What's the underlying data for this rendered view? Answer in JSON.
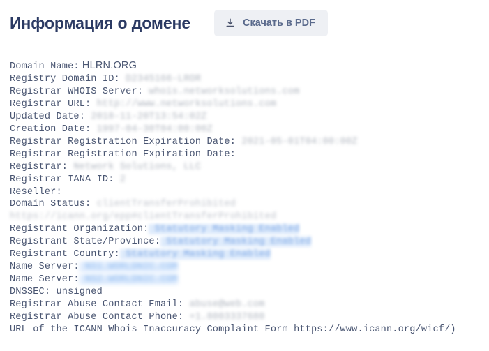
{
  "header": {
    "title": "Информация о домене",
    "download_button": {
      "label": "Скачать в PDF",
      "icon": "download-icon"
    }
  },
  "colors": {
    "title": "#2b3a63",
    "button_bg": "#eef0f4",
    "button_text": "#5a6a8c",
    "body_text": "#4a5672",
    "link_blue": "#5f93e0",
    "link_highlight": "#d9e8fb",
    "redacted_gray": "#9aa1ad",
    "page_bg": "#ffffff"
  },
  "whois": {
    "records": [
      {
        "label": "Domain Name:",
        "value": "HLRN.ORG",
        "style": "plain-sans"
      },
      {
        "label": "Registry Domain ID:",
        "value": "D2345166-LROR",
        "style": "redacted-gray"
      },
      {
        "label": "Registrar WHOIS Server:",
        "value": "whois.networksolutions.com",
        "style": "redacted-gray"
      },
      {
        "label": "Registrar URL:",
        "value": "http://www.networksolutions.com",
        "style": "redacted-gray"
      },
      {
        "label": "Updated Date:",
        "value": "2018-11-20T13:54:02Z",
        "style": "redacted-gray"
      },
      {
        "label": "Creation Date:",
        "value": "1997-04-30T04:00:00Z",
        "style": "redacted-gray"
      },
      {
        "label": "Registrar Registration Expiration Date:",
        "value": "2021-05-01T04:00:00Z",
        "style": "redacted-gray"
      },
      {
        "label": "Registrar Registration Expiration Date:",
        "value": "",
        "style": "redacted-gray"
      },
      {
        "label": "Registrar:",
        "value": "Network Solutions, LLC",
        "style": "redacted-gray"
      },
      {
        "label": "Registrar IANA ID:",
        "value": "2",
        "style": "redacted-gray"
      },
      {
        "label": "Reseller:",
        "value": "",
        "style": "plain"
      },
      {
        "label": "Domain Status:",
        "value": "clientTransferProhibited https://icann.org/epp#clientTransferProhibited",
        "style": "redacted-gray-link"
      },
      {
        "label": "Registrant Organization:",
        "value": "Statutory Masking Enabled",
        "style": "redacted-blue"
      },
      {
        "label": "Registrant State/Province:",
        "value": "Statutory Masking Enabled",
        "style": "redacted-blue"
      },
      {
        "label": "Registrant Country:",
        "value": "Statutory Masking Enabled",
        "style": "redacted-blue"
      },
      {
        "label": "Name Server:",
        "value": "NS1.WORLDNIC.COM",
        "style": "redacted-blue-strong"
      },
      {
        "label": "Name Server:",
        "value": "NS2.WORLDNIC.COM",
        "style": "redacted-blue-strong"
      },
      {
        "label": "DNSSEC:",
        "value": "unsigned",
        "style": "plain"
      },
      {
        "label": "Registrar Abuse Contact Email:",
        "value": "abuse@web.com",
        "style": "redacted-gray"
      },
      {
        "label": "Registrar Abuse Contact Phone:",
        "value": "+1.8003337680",
        "style": "redacted-gray"
      },
      {
        "label": "URL of the ICANN Whois Inaccuracy Complaint Form https://www.icann.org/wicf/)",
        "value": "",
        "style": "plain-wrap"
      }
    ]
  }
}
